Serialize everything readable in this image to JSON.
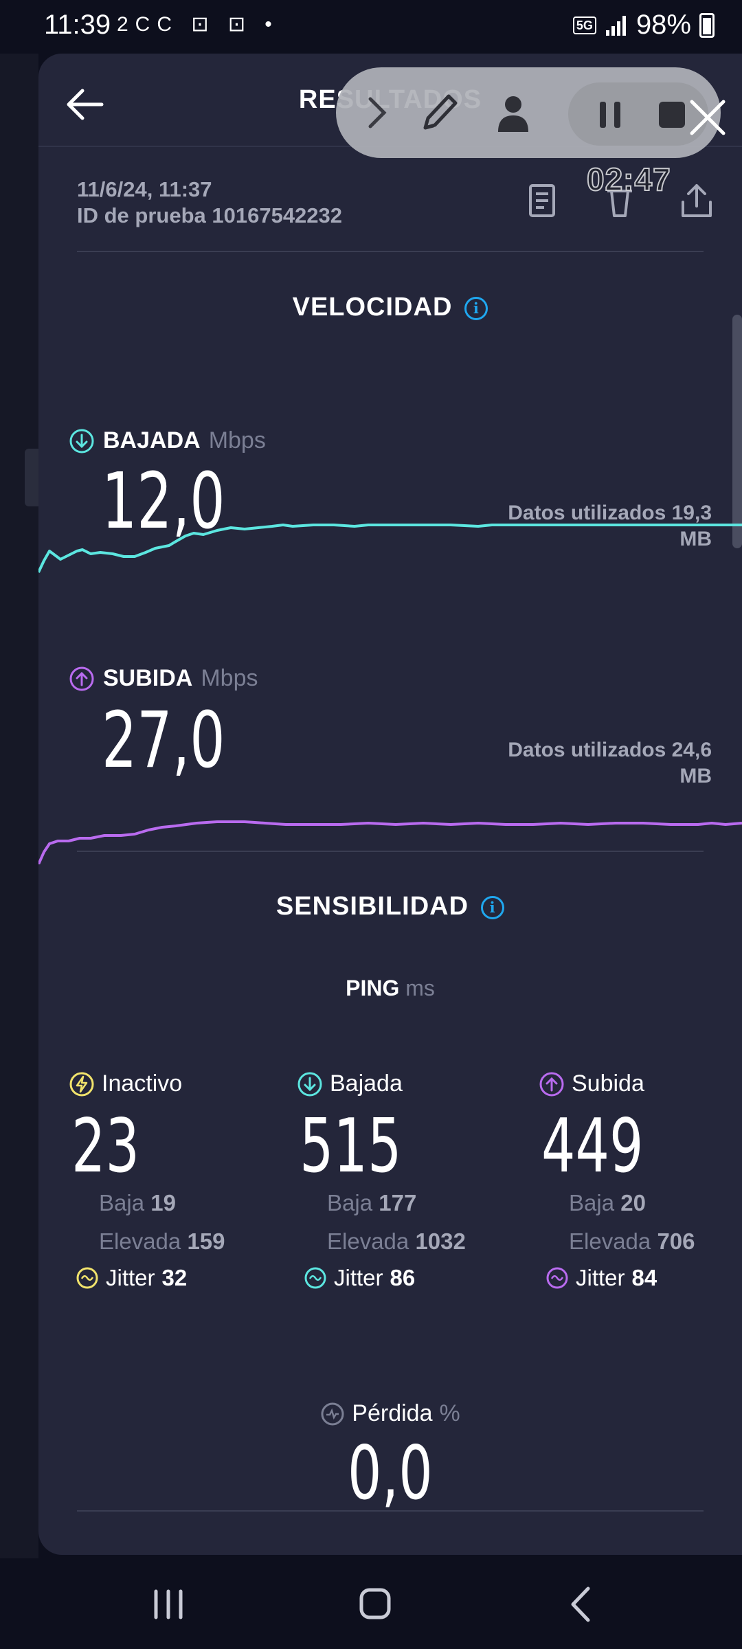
{
  "status_bar": {
    "time": "11:39",
    "left_icons": "2CC ⊡ ⊡ •",
    "network": "5G",
    "battery": "98%"
  },
  "header": {
    "title": "RESULTADOS"
  },
  "recorder": {
    "timer": "02:47"
  },
  "meta": {
    "date": "11/6/24, 11:37",
    "test_id": "ID de prueba 10167542232"
  },
  "speed": {
    "title": "VELOCIDAD",
    "unit": "Mbps",
    "download": {
      "label": "BAJADA",
      "value": "12,0",
      "data_used": "Datos utilizados 19,3",
      "data_unit": "MB"
    },
    "upload": {
      "label": "SUBIDA",
      "value": "27,0",
      "data_used": "Datos utilizados 24,6",
      "data_unit": "MB"
    }
  },
  "sensitivity": {
    "title": "SENSIBILIDAD",
    "ping_label": "PING",
    "ping_unit": "ms",
    "columns": [
      {
        "label": "Inactivo",
        "value": "23",
        "low_label": "Baja",
        "low": "19",
        "high_label": "Elevada",
        "high": "159",
        "jitter_label": "Jitter",
        "jitter": "32"
      },
      {
        "label": "Bajada",
        "value": "515",
        "low_label": "Baja",
        "low": "177",
        "high_label": "Elevada",
        "high": "1032",
        "jitter_label": "Jitter",
        "jitter": "86"
      },
      {
        "label": "Subida",
        "value": "449",
        "low_label": "Baja",
        "low": "20",
        "high_label": "Elevada",
        "high": "706",
        "jitter_label": "Jitter",
        "jitter": "84"
      }
    ],
    "loss_label": "Pérdida",
    "loss_unit": "%",
    "loss_value": "0,0"
  },
  "colors": {
    "download": "#5ce6e0",
    "upload": "#b96bef",
    "idle": "#f1e36c",
    "info": "#1fa7ef"
  }
}
